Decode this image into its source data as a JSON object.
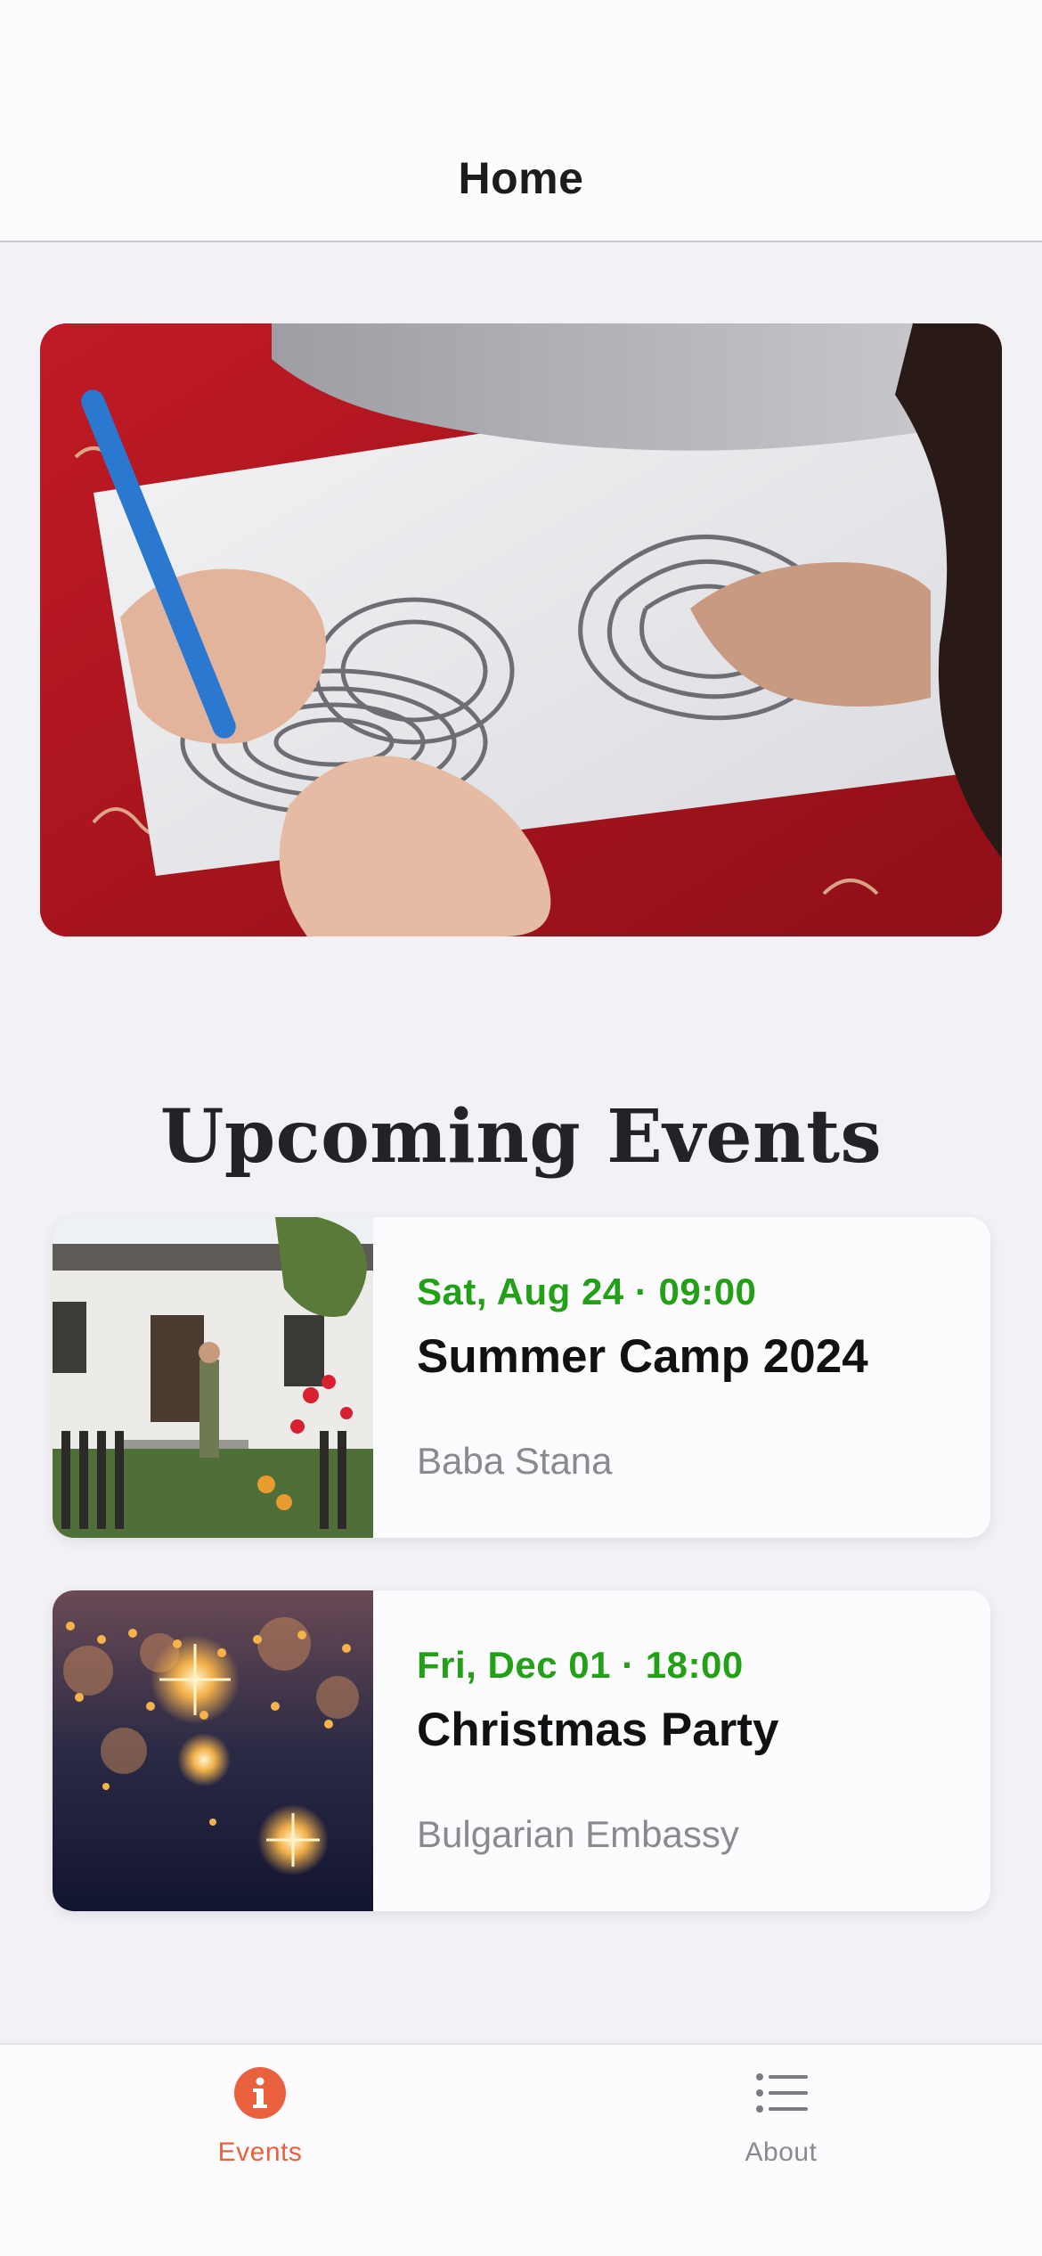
{
  "nav": {
    "title": "Home"
  },
  "hero": {
    "image_name": "children-drawing-maze-photo"
  },
  "section": {
    "title": "Upcoming Events"
  },
  "events": [
    {
      "date": "Sat, Aug 24 · 09:00",
      "title": "Summer Camp 2024",
      "location": "Baba Stana",
      "thumbnail": "school-building-photo"
    },
    {
      "date": "Fri, Dec 01 · 18:00",
      "title": "Christmas Party",
      "location": "Bulgarian Embassy",
      "thumbnail": "christmas-lights-photo"
    }
  ],
  "tabs": [
    {
      "label": "Events",
      "icon": "info-icon",
      "active": true
    },
    {
      "label": "About",
      "icon": "list-icon",
      "active": false
    }
  ],
  "colors": {
    "accent": "#e9613f",
    "date_green": "#22a117",
    "background": "#f2f1f5",
    "inactive_tab": "#8a8a8e"
  }
}
